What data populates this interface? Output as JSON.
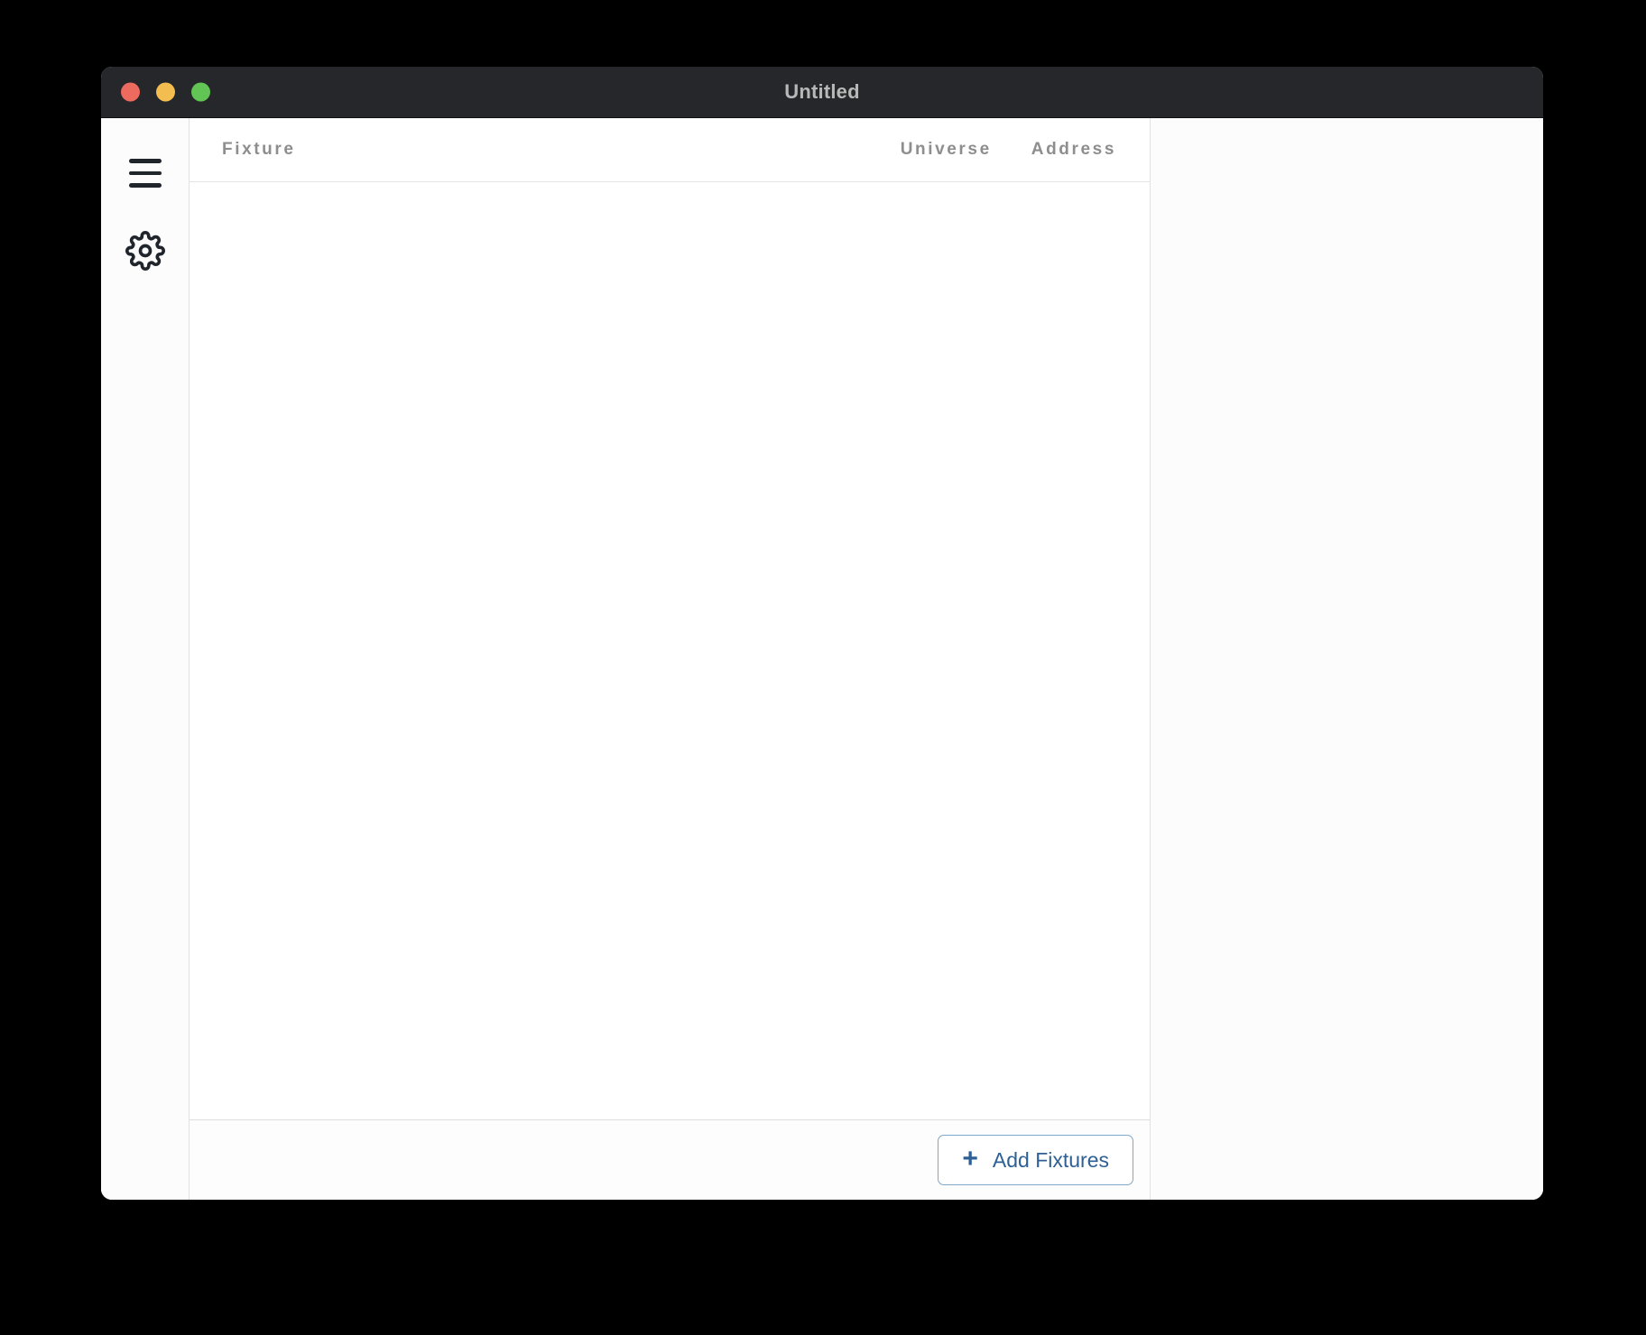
{
  "window": {
    "title": "Untitled",
    "traffic_lights": [
      {
        "name": "close",
        "color": "#ec6a5e"
      },
      {
        "name": "minimize",
        "color": "#f4bd4f"
      },
      {
        "name": "zoom",
        "color": "#61c454"
      }
    ]
  },
  "sidebar": {
    "items": [
      {
        "id": "menu",
        "icon": "hamburger-menu-icon",
        "label": "Menu"
      },
      {
        "id": "settings",
        "icon": "gear-icon",
        "label": "Settings"
      }
    ]
  },
  "fixture_panel": {
    "columns": [
      {
        "id": "fixture",
        "label": "Fixture"
      },
      {
        "id": "universe",
        "label": "Universe"
      },
      {
        "id": "address",
        "label": "Address"
      }
    ],
    "rows": [],
    "empty_message": "",
    "footer": {
      "add_button_label": "Add Fixtures",
      "add_button_icon": "plus-icon"
    }
  },
  "inspector_panel": {
    "content": ""
  },
  "colors": {
    "accent_blue": "#2e6095",
    "accent_border": "#7ea7ca",
    "titlebar_bg": "#26272a",
    "header_text": "#8e8e8e"
  }
}
